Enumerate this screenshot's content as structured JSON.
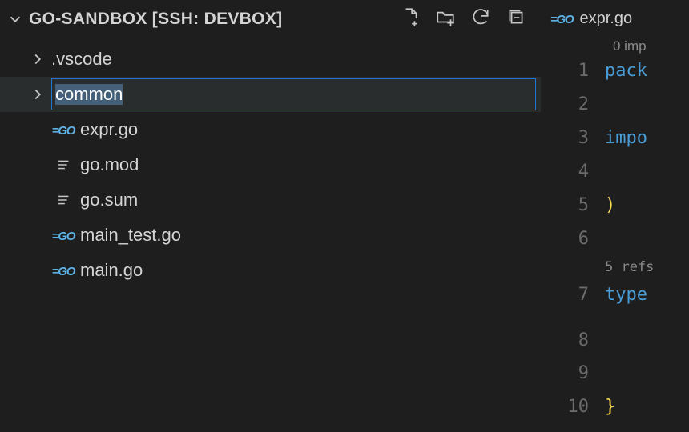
{
  "sidebar": {
    "title": "GO-SANDBOX [SSH: DEVBOX]",
    "folder_vscode": ".vscode",
    "rename_value": "common",
    "files": {
      "expr": "expr.go",
      "gomod": "go.mod",
      "gosum": "go.sum",
      "maintest": "main_test.go",
      "main": "main.go"
    }
  },
  "editor": {
    "tab_filename": "expr.go",
    "annotation_top": "0 imp",
    "gutter": {
      "1": "1",
      "2": "2",
      "3": "3",
      "4": "4",
      "5": "5",
      "6": "6",
      "7": "7",
      "8": "8",
      "9": "9",
      "10": "10"
    },
    "lines": {
      "l1_kw": "pack",
      "l3_kw": "impo",
      "l5_br": ")",
      "refs": "5 refs",
      "l7_kw": "type",
      "l10_br": "}"
    }
  }
}
